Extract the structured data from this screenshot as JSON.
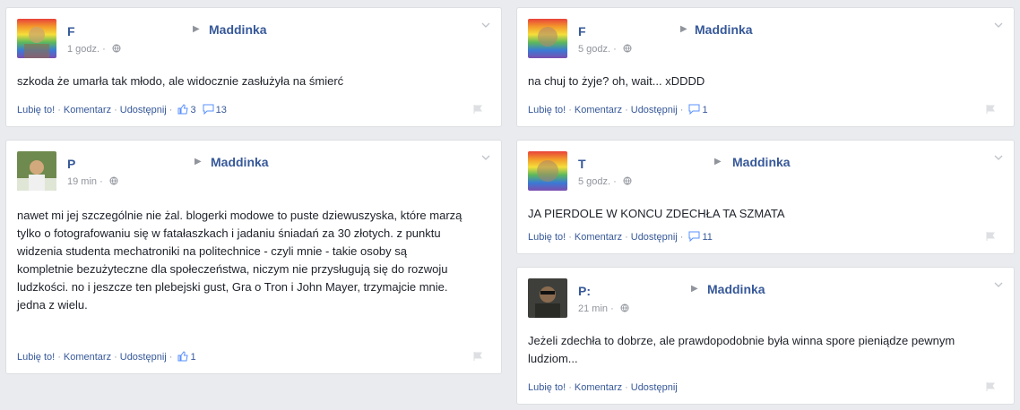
{
  "posts": [
    {
      "author": "F",
      "target": "Maddinka",
      "time": "1 godz.",
      "text": "szkoda że umarła tak młodo, ale widocznie zasłużyła na śmierć",
      "like_label": "Lubię to!",
      "comment_label": "Komentarz",
      "share_label": "Udostępnij",
      "like_count": "3",
      "comment_count": "13"
    },
    {
      "author": "F",
      "target": "Maddinka",
      "time": "5 godz.",
      "text": "na chuj to żyje? oh, wait... xDDDD",
      "like_label": "Lubię to!",
      "comment_label": "Komentarz",
      "share_label": "Udostępnij",
      "comment_count": "1"
    },
    {
      "author": "P",
      "target": "Maddinka",
      "time": "19 min",
      "text": "nawet mi jej szczególnie nie żal. blogerki modowe to puste dziewuszyska, które marzą tylko o fotografowaniu się w fatałaszkach i jadaniu śniadań za 30 złotych. z punktu widzenia studenta mechatroniki na politechnice - czyli mnie - takie osoby są kompletnie bezużyteczne dla społeczeństwa, niczym nie przysługują się do rozwoju ludzkości. no i jeszcze ten plebejski gust, Gra o Tron i John Mayer, trzymajcie mnie. jedna z wielu.",
      "like_label": "Lubię to!",
      "comment_label": "Komentarz",
      "share_label": "Udostępnij",
      "like_count": "1"
    },
    {
      "author": "T",
      "target": "Maddinka",
      "time": "5 godz.",
      "text": "JA PIERDOLE W KONCU ZDECHŁA TA SZMATA",
      "like_label": "Lubię to!",
      "comment_label": "Komentarz",
      "share_label": "Udostępnij",
      "comment_count": "11"
    },
    {
      "author": "P:",
      "target": "Maddinka",
      "time": "21 min",
      "text": "Jeżeli zdechła to dobrze, ale prawdopodobnie była winna spore pieniądze pewnym ludziom...",
      "like_label": "Lubię to!",
      "comment_label": "Komentarz",
      "share_label": "Udostępnij"
    }
  ]
}
